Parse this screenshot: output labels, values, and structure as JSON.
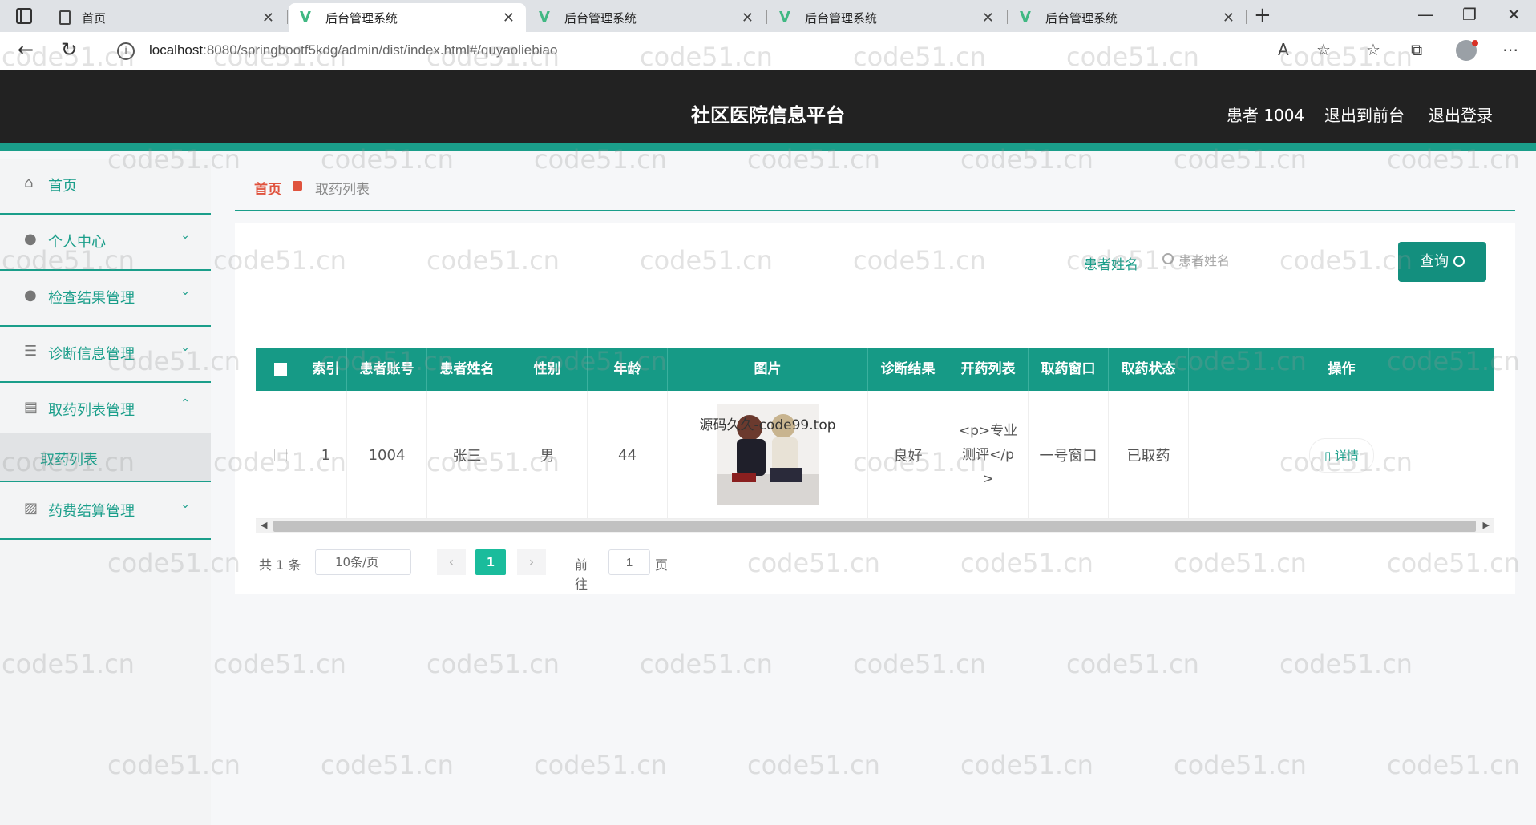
{
  "browser": {
    "tabs": [
      {
        "title": "首页",
        "icon": "document-icon"
      },
      {
        "title": "后台管理系统",
        "icon": "vue-icon"
      },
      {
        "title": "后台管理系统",
        "icon": "vue-icon"
      },
      {
        "title": "后台管理系统",
        "icon": "vue-icon"
      },
      {
        "title": "后台管理系统",
        "icon": "vue-icon"
      }
    ],
    "url_host": "localhost",
    "url_rest": ":8080/springbootf5kdg/admin/dist/index.html#/quyaoliebiao"
  },
  "header": {
    "title": "社区医院信息平台",
    "user": "患者 1004",
    "to_front": "退出到前台",
    "logout": "退出登录"
  },
  "sidebar": {
    "items": [
      {
        "label": "首页",
        "icon": "home-icon"
      },
      {
        "label": "个人中心",
        "icon": "user-icon"
      },
      {
        "label": "检查结果管理",
        "icon": "user-icon"
      },
      {
        "label": "诊断信息管理",
        "icon": "list-icon"
      },
      {
        "label": "取药列表管理",
        "icon": "briefcase-icon"
      },
      {
        "label": "药费结算管理",
        "icon": "chart-icon"
      }
    ],
    "sub_active": "取药列表"
  },
  "breadcrumb": {
    "home": "首页",
    "current": "取药列表"
  },
  "search": {
    "label": "患者姓名",
    "placeholder": "患者姓名",
    "button": "查询"
  },
  "table": {
    "headers": [
      "索引",
      "患者账号",
      "患者姓名",
      "性别",
      "年龄",
      "图片",
      "诊断结果",
      "开药列表",
      "取药窗口",
      "取药状态",
      "操作"
    ],
    "rows": [
      {
        "index": "1",
        "account": "1004",
        "name": "张三",
        "gender": "男",
        "age": "44",
        "image_caption": "源码久久-code99.top",
        "diagnosis": "良好",
        "prescription": "<p>专业测评</p>",
        "window": "一号窗口",
        "status": "已取药",
        "action": "详情"
      }
    ]
  },
  "pager": {
    "total": "共 1 条",
    "page_size": "10条/页",
    "current": "1",
    "goto": "前往",
    "goto_value": "1",
    "page_suffix": "页"
  },
  "watermark": "code51.cn",
  "colors": {
    "accent": "#1a9e8a",
    "header_bg": "#222222",
    "breadcrumb_home": "#e0533e"
  }
}
